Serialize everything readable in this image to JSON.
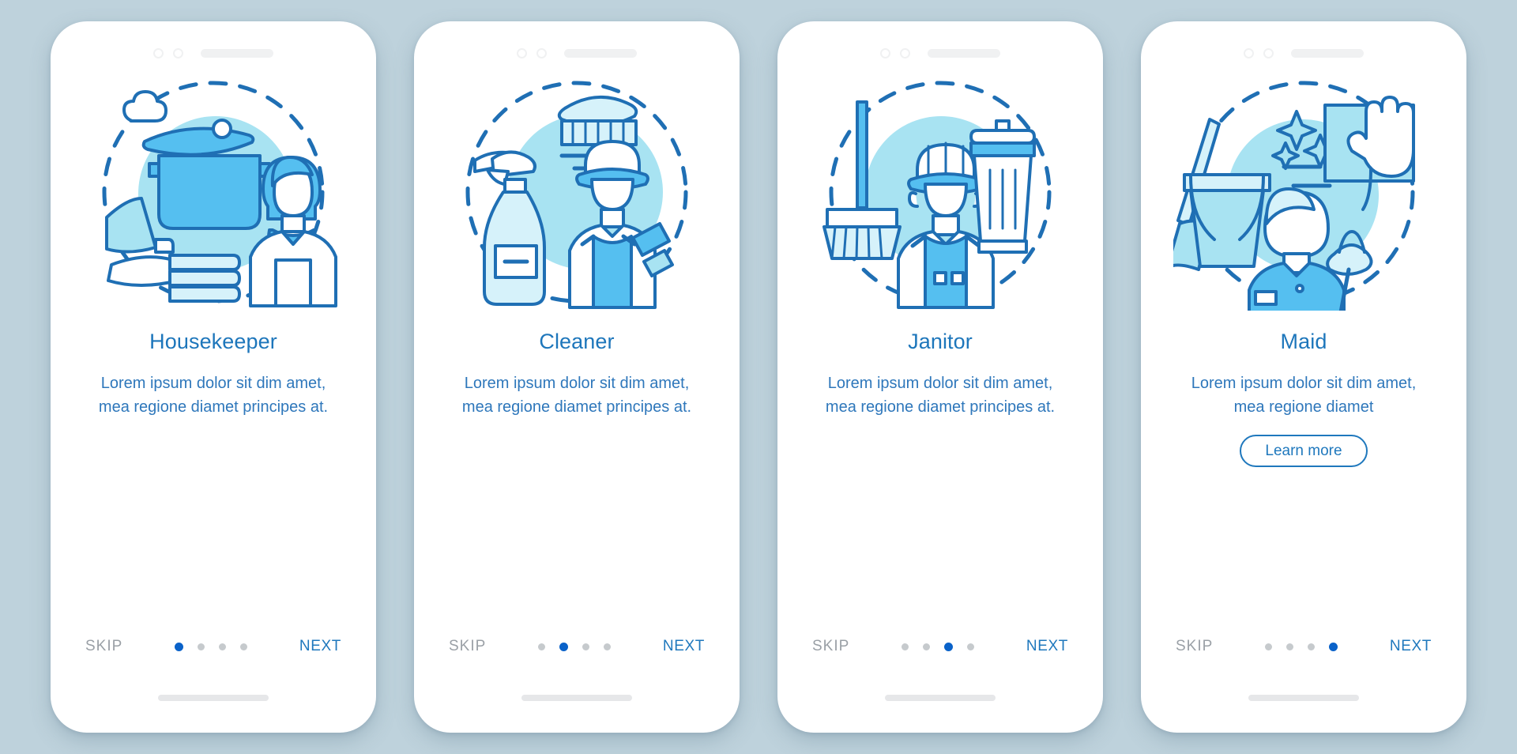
{
  "page": {
    "background_color": "#bed2dc",
    "card_background": "#ffffff",
    "accent_color": "#1f78bd",
    "title_color": "#1d76bb",
    "body_color": "#2e77bb",
    "illustration_fill": "#a8e3f2",
    "illustration_mid": "#55bff0",
    "illustration_stroke": "#1f6fb4",
    "dot_inactive_color": "#c6cacd",
    "dot_active_color": "#0a62c9",
    "skip_color": "#9aa0a6"
  },
  "cards": [
    {
      "title": "Housekeeper",
      "description": "Lorem ipsum dolor sit dim amet, mea regione diamet principes at.",
      "skip_label": "SKIP",
      "next_label": "NEXT",
      "dot_count": 4,
      "active_dot": 1,
      "illustration": "housekeeper-illustration",
      "has_learn_more": false,
      "learn_more_label": ""
    },
    {
      "title": "Cleaner",
      "description": "Lorem ipsum dolor sit dim amet, mea regione diamet principes at.",
      "skip_label": "SKIP",
      "next_label": "NEXT",
      "dot_count": 4,
      "active_dot": 2,
      "illustration": "cleaner-illustration",
      "has_learn_more": false,
      "learn_more_label": ""
    },
    {
      "title": "Janitor",
      "description": "Lorem ipsum dolor sit dim amet, mea regione diamet principes at.",
      "skip_label": "SKIP",
      "next_label": "NEXT",
      "dot_count": 4,
      "active_dot": 3,
      "illustration": "janitor-illustration",
      "has_learn_more": false,
      "learn_more_label": ""
    },
    {
      "title": "Maid",
      "description": "Lorem ipsum dolor sit dim amet, mea regione diamet",
      "skip_label": "SKIP",
      "next_label": "NEXT",
      "dot_count": 4,
      "active_dot": 4,
      "illustration": "maid-illustration",
      "has_learn_more": true,
      "learn_more_label": "Learn more"
    }
  ]
}
